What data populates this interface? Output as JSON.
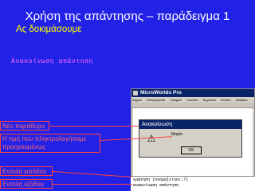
{
  "slide": {
    "title": "Χρήση της απάντησης – παράδειγμα 1",
    "subtitle": "Ας δοκιμάσουμε",
    "link_text": "Ανακοίνωση απάντηση"
  },
  "callouts": {
    "new_window": "Νέο παράθυρο",
    "typed_value": "Η τιμή που πληκτρολογήσαμε προηγουμένως",
    "input_command": "Εντολή εισόδου",
    "output_command": "Εντολή εξόδου"
  },
  "microworlds": {
    "title": "MicroWorlds Pro",
    "menu_items": [
      "Αρχείο",
      "Επεξεργασία",
      "Γραφικά",
      "Γλώσσα",
      "Εργαλεία",
      "Σελίδες",
      "Βοήθεια"
    ]
  },
  "alert": {
    "title": "Ανακοίνωση",
    "icon": "warning-icon",
    "message": "Μαρία",
    "ok_label": "OK"
  },
  "command_center": {
    "line1": "ερώτηση [ονομα]είναι;?]",
    "line2": "ανακοίνωση απάντηση"
  },
  "colors": {
    "background": "#2222e6",
    "title": "#ffffff",
    "subtitle": "#ffff00",
    "link": "#ff66ff",
    "callout": "#ff4040"
  }
}
